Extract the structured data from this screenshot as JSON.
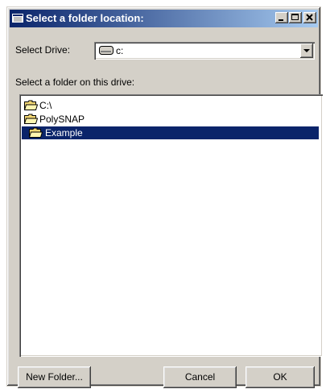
{
  "window": {
    "title": "Select a folder location:",
    "title_icon": "folder-window-icon",
    "controls": [
      "minimize-icon",
      "maximize-icon",
      "close-icon"
    ]
  },
  "drive": {
    "label": "Select Drive:",
    "selected": "c:",
    "icon": "drive-icon"
  },
  "folder_section": {
    "label": "Select a folder on this drive:"
  },
  "tree": {
    "items": [
      {
        "label": "C:\\",
        "icon": "open-folder-icon",
        "selected": false
      },
      {
        "label": "PolySNAP",
        "icon": "open-folder-icon",
        "selected": false
      },
      {
        "label": "Example",
        "icon": "open-folder-icon",
        "selected": true
      }
    ]
  },
  "buttons": {
    "new_folder": "New Folder...",
    "cancel": "Cancel",
    "ok": "OK"
  },
  "colors": {
    "title_bar": "#0a246a",
    "selection": "#0a246a",
    "face": "#d4d0c8",
    "folder": "#f2d774"
  }
}
